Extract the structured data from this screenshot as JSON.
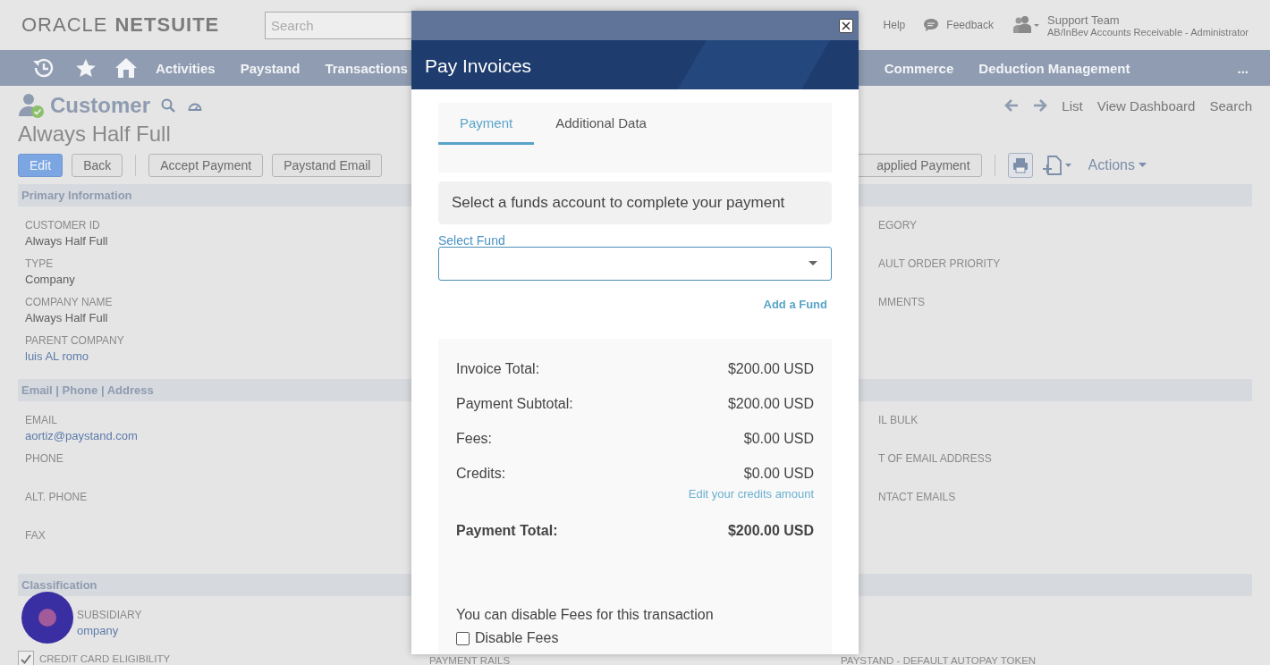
{
  "header": {
    "logo": {
      "brand": "ORACLE",
      "product": "NETSUITE"
    },
    "search": {
      "placeholder": "Search"
    },
    "links": [
      "Help",
      "Feedback"
    ],
    "user": {
      "name": "Support Team",
      "role": "AB/InBev Accounts Receivable - Administrator"
    }
  },
  "nav": {
    "menu_left": [
      "Activities",
      "Paystand",
      "Transactions"
    ],
    "menu_right": [
      "Commerce",
      "Deduction Management"
    ],
    "more": "..."
  },
  "record": {
    "type": "Customer",
    "title": "Always Half Full",
    "links": [
      "List",
      "View Dashboard",
      "Search"
    ],
    "button_groups": [
      [
        {
          "label": "Edit",
          "primary": true
        },
        {
          "label": "Back",
          "primary": false
        }
      ],
      [
        {
          "label": "Accept Payment",
          "primary": false
        },
        {
          "label": "Paystand Email",
          "primary": false
        }
      ]
    ],
    "right_button": "applied Payment",
    "actions": "Actions"
  },
  "sections": [
    {
      "title": "Primary Information",
      "rows": [
        [
          {
            "kind": "field",
            "label": "CUSTOMER ID",
            "value": "Always Half Full"
          },
          null,
          {
            "kind": "cut-field",
            "label": "EGORY"
          }
        ],
        [
          {
            "kind": "field",
            "label": "TYPE",
            "value": "Company"
          },
          null,
          {
            "kind": "cut-field",
            "label": "AULT ORDER PRIORITY"
          }
        ],
        [
          {
            "kind": "field",
            "label": "COMPANY NAME",
            "value": "Always Half Full"
          },
          null,
          {
            "kind": "cut-field",
            "label": "MMENTS"
          }
        ],
        [
          {
            "kind": "field",
            "label": "PARENT COMPANY",
            "value": "luis AL romo",
            "link": true
          },
          null,
          null
        ]
      ]
    },
    {
      "title": "Email | Phone | Address",
      "rows": [
        [
          {
            "kind": "field",
            "label": "EMAIL",
            "value": "aortiz@paystand.com",
            "link": true
          },
          null,
          {
            "kind": "cut-field",
            "label": "IL BULK"
          }
        ],
        [
          {
            "kind": "field",
            "label": "PHONE"
          },
          null,
          {
            "kind": "cut-field",
            "label": "T OF EMAIL ADDRESS"
          }
        ],
        [
          {
            "kind": "field",
            "label": "ALT. PHONE"
          },
          null,
          {
            "kind": "cut-field",
            "label": "NTACT EMAILS"
          }
        ],
        [
          {
            "kind": "field",
            "label": "FAX"
          },
          null,
          null
        ]
      ]
    },
    {
      "title": "Classification",
      "rows": [
        [
          {
            "kind": "cut-field",
            "label": "SUBSIDIARY",
            "value": "ompany",
            "link": true
          },
          null,
          null
        ],
        [
          {
            "kind": "checkbox",
            "label": "CREDIT CARD ELIGIBILITY",
            "checked": true
          },
          {
            "kind": "field",
            "label": "PAYMENT RAILS"
          },
          {
            "kind": "field",
            "label": "PAYSTAND - DEFAULT AUTOPAY TOKEN"
          }
        ]
      ]
    }
  ],
  "modal": {
    "title": "Pay Invoices",
    "tabs": [
      {
        "label": "Payment",
        "selected": true
      },
      {
        "label": "Additional Data",
        "selected": false
      }
    ],
    "notice": "Select a funds account to complete your payment",
    "fund_select": {
      "label": "Select Fund"
    },
    "add_fund": "Add a Fund",
    "summary": [
      {
        "label": "Invoice Total:",
        "value": "$200.00 USD"
      },
      {
        "label": "Payment Subtotal:",
        "value": "$200.00 USD"
      },
      {
        "label": "Fees:",
        "value": "$0.00 USD"
      },
      {
        "label": "Credits:",
        "value": "$0.00 USD"
      }
    ],
    "edit_credits": "Edit your credits amount",
    "total": {
      "label": "Payment Total:",
      "value": "$200.00 USD"
    },
    "fee_note": "You can disable Fees for this transaction",
    "disable_fees": {
      "label": "Disable Fees",
      "checked": false
    }
  }
}
